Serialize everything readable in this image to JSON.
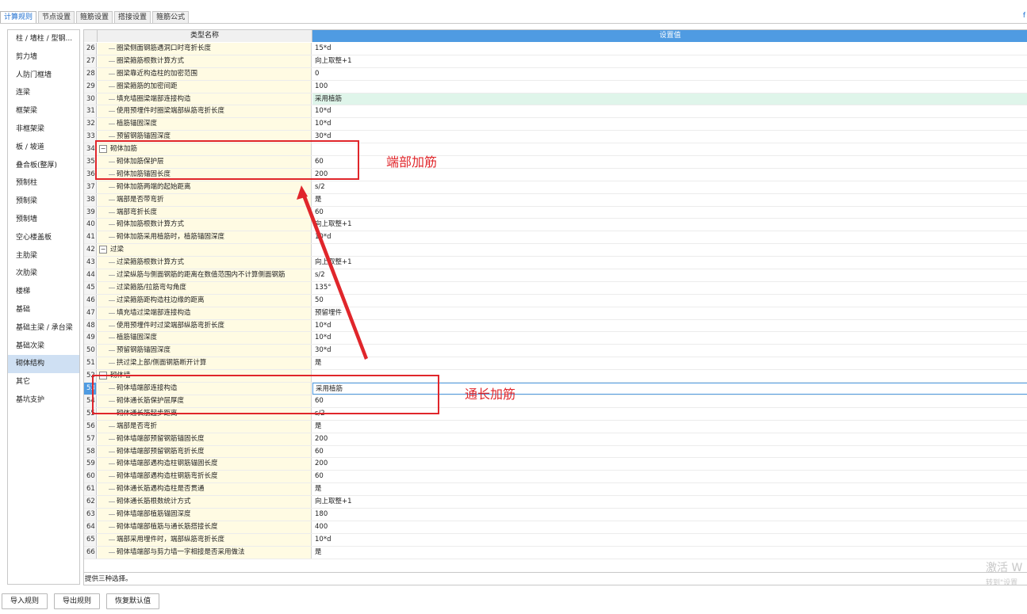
{
  "tabs": [
    "计算规则",
    "节点设置",
    "箍筋设置",
    "搭接设置",
    "箍筋公式"
  ],
  "right_mark": "f",
  "sidebar": [
    "柱 / 墙柱 / 型钢...",
    "剪力墙",
    "人防门框墙",
    "连梁",
    "框架梁",
    "非框架梁",
    "板 / 坡道",
    "叠合板(整厚)",
    "预制柱",
    "预制梁",
    "预制墙",
    "空心楼盖板",
    "主肋梁",
    "次肋梁",
    "楼梯",
    "基础",
    "基础主梁 / 承台梁",
    "基础次梁",
    "砌体结构",
    "其它",
    "基坑支护"
  ],
  "sidebar_selected": "砌体结构",
  "grid": {
    "col_name": "类型名称",
    "col_value": "设置值",
    "rows": [
      {
        "num": "26",
        "name": "圈梁侧面钢筋遇洞口时弯折长度",
        "value": "15*d"
      },
      {
        "num": "27",
        "name": "圈梁箍筋根数计算方式",
        "value": "向上取整+1"
      },
      {
        "num": "28",
        "name": "圈梁靠近构造柱的加密范围",
        "value": "0"
      },
      {
        "num": "29",
        "name": "圈梁箍筋的加密间距",
        "value": "100"
      },
      {
        "num": "30",
        "name": "填充墙圈梁端部连接构造",
        "value": "采用植筋"
      },
      {
        "num": "31",
        "name": "使用预埋件时圈梁端部纵筋弯折长度",
        "value": "10*d"
      },
      {
        "num": "32",
        "name": "植筋锚固深度",
        "value": "10*d"
      },
      {
        "num": "33",
        "name": "预留钢筋锚固深度",
        "value": "30*d"
      },
      {
        "num": "34",
        "name": "砌体加筋",
        "value": "",
        "group": true
      },
      {
        "num": "35",
        "name": "砌体加筋保护层",
        "value": "60"
      },
      {
        "num": "36",
        "name": "砌体加筋锚固长度",
        "value": "200"
      },
      {
        "num": "37",
        "name": "砌体加筋两端的起始距离",
        "value": "s/2"
      },
      {
        "num": "38",
        "name": "端部是否带弯折",
        "value": "是"
      },
      {
        "num": "39",
        "name": "端部弯折长度",
        "value": "60"
      },
      {
        "num": "40",
        "name": "砌体加筋根数计算方式",
        "value": "向上取整+1"
      },
      {
        "num": "41",
        "name": "砌体加筋采用植筋时，植筋锚固深度",
        "value": "10*d"
      },
      {
        "num": "42",
        "name": "过梁",
        "value": "",
        "group": true
      },
      {
        "num": "43",
        "name": "过梁箍筋根数计算方式",
        "value": "向上取整+1"
      },
      {
        "num": "44",
        "name": "过梁纵筋与侧面钢筋的距离在数值范围内不计算侧面钢筋",
        "value": "s/2"
      },
      {
        "num": "45",
        "name": "过梁箍筋/拉筋弯勾角度",
        "value": "135°"
      },
      {
        "num": "46",
        "name": "过梁箍筋距构造柱边缘的距离",
        "value": "50"
      },
      {
        "num": "47",
        "name": "填充墙过梁端部连接构造",
        "value": "预留埋件"
      },
      {
        "num": "48",
        "name": "使用预埋件时过梁端部纵筋弯折长度",
        "value": "10*d"
      },
      {
        "num": "49",
        "name": "植筋锚固深度",
        "value": "10*d"
      },
      {
        "num": "50",
        "name": "预留钢筋锚固深度",
        "value": "30*d"
      },
      {
        "num": "51",
        "name": "拱过梁上部/侧面钢筋断开计算",
        "value": "是"
      },
      {
        "num": "52",
        "name": "砌体墙",
        "value": "",
        "group": true
      },
      {
        "num": "53",
        "name": "砌体墙端部连接构造",
        "value": "采用植筋"
      },
      {
        "num": "54",
        "name": "砌体通长筋保护层厚度",
        "value": "60"
      },
      {
        "num": "55",
        "name": "砌体通长筋起步距离",
        "value": "s/2"
      },
      {
        "num": "56",
        "name": "端部是否弯折",
        "value": "是"
      },
      {
        "num": "57",
        "name": "砌体墙端部预留钢筋锚固长度",
        "value": "200"
      },
      {
        "num": "58",
        "name": "砌体墙端部预留钢筋弯折长度",
        "value": "60"
      },
      {
        "num": "59",
        "name": "砌体墙端部遇构造柱钢筋锚固长度",
        "value": "200"
      },
      {
        "num": "60",
        "name": "砌体墙端部遇构造柱钢筋弯折长度",
        "value": "60"
      },
      {
        "num": "61",
        "name": "砌体通长筋遇构造柱是否贯通",
        "value": "是"
      },
      {
        "num": "62",
        "name": "砌体通长筋根数统计方式",
        "value": "向上取整+1"
      },
      {
        "num": "63",
        "name": "砌体墙端部植筋锚固深度",
        "value": "180"
      },
      {
        "num": "64",
        "name": "砌体墙端部植筋与通长筋搭接长度",
        "value": "400"
      },
      {
        "num": "65",
        "name": "端部采用埋件时，端部纵筋弯折长度",
        "value": "10*d"
      },
      {
        "num": "66",
        "name": "砌体墙端部与剪力墙一字相接是否采用做法",
        "value": "是"
      }
    ],
    "description": "提供三种选择。"
  },
  "annotations": {
    "label_top": "端部加筋",
    "label_bottom": "通长加筋",
    "color": "#e0262b"
  },
  "buttons": [
    "导入规则",
    "导出规则",
    "恢复默认值"
  ],
  "watermark": {
    "line1": "激活 W",
    "line2": "转到\"设置"
  }
}
